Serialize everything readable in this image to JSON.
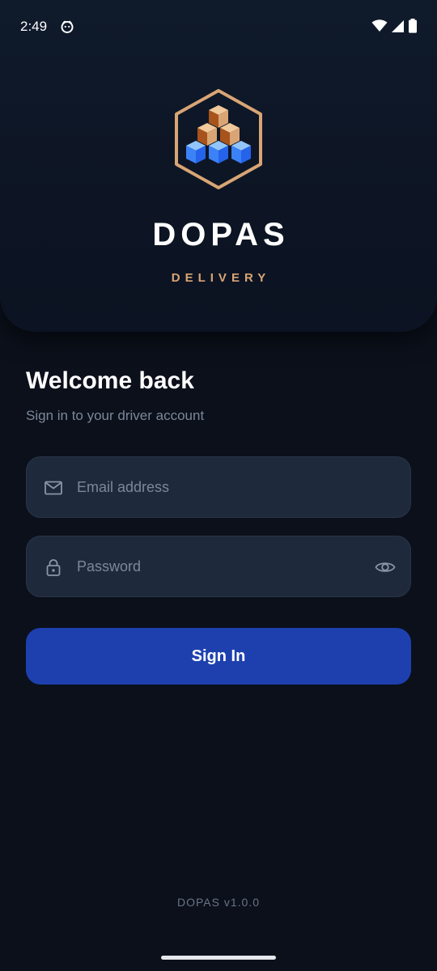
{
  "status_bar": {
    "time": "2:49"
  },
  "brand": {
    "name": "DOPAS",
    "tagline": "DELIVERY",
    "accent_color": "#d9a575"
  },
  "login": {
    "title": "Welcome back",
    "subtitle": "Sign in to your driver account",
    "email": {
      "placeholder": "Email address",
      "value": "",
      "icon": "mail-icon"
    },
    "password": {
      "placeholder": "Password",
      "value": "",
      "icon": "lock-icon",
      "toggle_icon": "eye-icon"
    },
    "submit_label": "Sign In",
    "submit_color": "#1e40af"
  },
  "footer": {
    "version": "DOPAS v1.0.0"
  }
}
